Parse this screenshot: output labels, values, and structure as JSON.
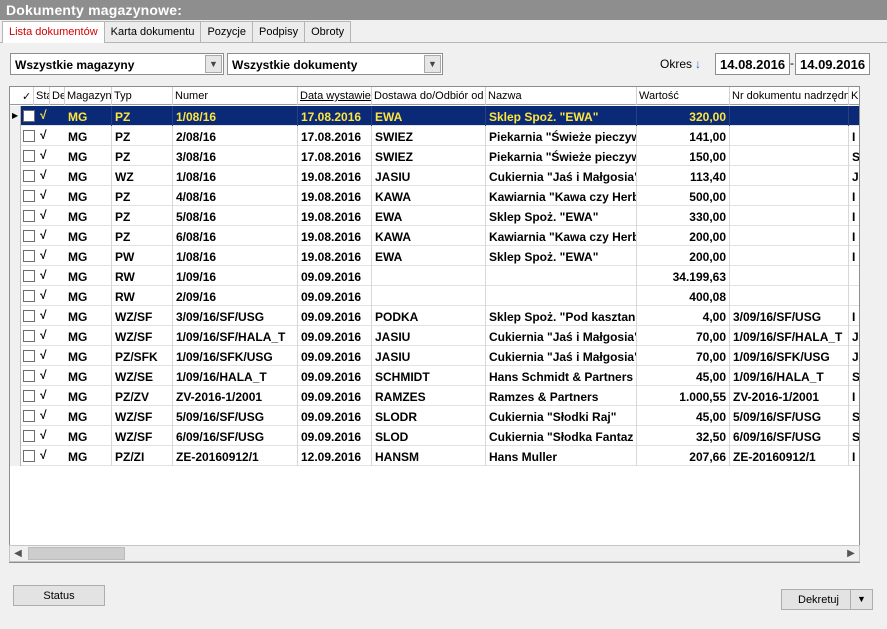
{
  "window": {
    "title": "Dokumenty magazynowe:"
  },
  "tabs": [
    {
      "label": "Lista dokumentów",
      "active": true
    },
    {
      "label": "Karta dokumentu",
      "active": false
    },
    {
      "label": "Pozycje",
      "active": false
    },
    {
      "label": "Podpisy",
      "active": false
    },
    {
      "label": "Obroty",
      "active": false
    }
  ],
  "filters": {
    "warehouse": "Wszystkie magazyny",
    "documents": "Wszystkie dokumenty",
    "period_label": "Okres",
    "date_from": "14.08.2016",
    "date_to": "14.09.2016",
    "date_separator": "-"
  },
  "table": {
    "headers": [
      "Sta",
      "De",
      "Magazyn",
      "Typ",
      "Numer",
      "Data wystawienia",
      "Dostawa do/Odbiór od",
      "Nazwa",
      "Wartość",
      "Nr dokumentu nadrzędnego",
      "K"
    ],
    "rows": [
      {
        "mag": "MG",
        "typ": "PZ",
        "numer": "1/08/16",
        "data": "17.08.2016",
        "dostawa": "EWA",
        "nazwa": "Sklep Spoż. \"EWA\"",
        "wartosc": "320,00",
        "nadrz": "",
        "k": "",
        "selected": true
      },
      {
        "mag": "MG",
        "typ": "PZ",
        "numer": "2/08/16",
        "data": "17.08.2016",
        "dostawa": "SWIEZ",
        "nazwa": "Piekarnia \"Świeże pieczyw",
        "wartosc": "141,00",
        "nadrz": "",
        "k": "I"
      },
      {
        "mag": "MG",
        "typ": "PZ",
        "numer": "3/08/16",
        "data": "17.08.2016",
        "dostawa": "SWIEZ",
        "nazwa": "Piekarnia \"Świeże pieczyw",
        "wartosc": "150,00",
        "nadrz": "",
        "k": "S"
      },
      {
        "mag": "MG",
        "typ": "WZ",
        "numer": "1/08/16",
        "data": "19.08.2016",
        "dostawa": "JASIU",
        "nazwa": "Cukiernia \"Jaś i Małgosia\"",
        "wartosc": "113,40",
        "nadrz": "",
        "k": "J"
      },
      {
        "mag": "MG",
        "typ": "PZ",
        "numer": "4/08/16",
        "data": "19.08.2016",
        "dostawa": "KAWA",
        "nazwa": "Kawiarnia \"Kawa czy Herb",
        "wartosc": "500,00",
        "nadrz": "",
        "k": "I"
      },
      {
        "mag": "MG",
        "typ": "PZ",
        "numer": "5/08/16",
        "data": "19.08.2016",
        "dostawa": "EWA",
        "nazwa": "Sklep Spoż. \"EWA\"",
        "wartosc": "330,00",
        "nadrz": "",
        "k": "I"
      },
      {
        "mag": "MG",
        "typ": "PZ",
        "numer": "6/08/16",
        "data": "19.08.2016",
        "dostawa": "KAWA",
        "nazwa": "Kawiarnia \"Kawa czy Herb",
        "wartosc": "200,00",
        "nadrz": "",
        "k": "I"
      },
      {
        "mag": "MG",
        "typ": "PW",
        "numer": "1/08/16",
        "data": "19.08.2016",
        "dostawa": "EWA",
        "nazwa": "Sklep Spoż. \"EWA\"",
        "wartosc": "200,00",
        "nadrz": "",
        "k": "I"
      },
      {
        "mag": "MG",
        "typ": "RW",
        "numer": "1/09/16",
        "data": "09.09.2016",
        "dostawa": "",
        "nazwa": "",
        "wartosc": "34.199,63",
        "nadrz": "",
        "k": ""
      },
      {
        "mag": "MG",
        "typ": "RW",
        "numer": "2/09/16",
        "data": "09.09.2016",
        "dostawa": "",
        "nazwa": "",
        "wartosc": "400,08",
        "nadrz": "",
        "k": ""
      },
      {
        "mag": "MG",
        "typ": "WZ/SF",
        "numer": "3/09/16/SF/USG",
        "data": "09.09.2016",
        "dostawa": "PODKA",
        "nazwa": "Sklep Spoż. \"Pod kasztan",
        "wartosc": "4,00",
        "nadrz": "3/09/16/SF/USG",
        "k": "I"
      },
      {
        "mag": "MG",
        "typ": "WZ/SF",
        "numer": "1/09/16/SF/HALA_T",
        "data": "09.09.2016",
        "dostawa": "JASIU",
        "nazwa": "Cukiernia \"Jaś i Małgosia\"",
        "wartosc": "70,00",
        "nadrz": "1/09/16/SF/HALA_T",
        "k": "J"
      },
      {
        "mag": "MG",
        "typ": "PZ/SFK",
        "numer": "1/09/16/SFK/USG",
        "data": "09.09.2016",
        "dostawa": "JASIU",
        "nazwa": "Cukiernia \"Jaś i Małgosia\"",
        "wartosc": "70,00",
        "nadrz": "1/09/16/SFK/USG",
        "k": "J"
      },
      {
        "mag": "MG",
        "typ": "WZ/SE",
        "numer": "1/09/16/HALA_T",
        "data": "09.09.2016",
        "dostawa": "SCHMIDT",
        "nazwa": "Hans Schmidt & Partners",
        "wartosc": "45,00",
        "nadrz": "1/09/16/HALA_T",
        "k": "S"
      },
      {
        "mag": "MG",
        "typ": "PZ/ZV",
        "numer": "ZV-2016-1/2001",
        "data": "09.09.2016",
        "dostawa": "RAMZES",
        "nazwa": "Ramzes & Partners",
        "wartosc": "1.000,55",
        "nadrz": "ZV-2016-1/2001",
        "k": "I"
      },
      {
        "mag": "MG",
        "typ": "WZ/SF",
        "numer": "5/09/16/SF/USG",
        "data": "09.09.2016",
        "dostawa": "SLODR",
        "nazwa": "Cukiernia \"Słodki Raj\"",
        "wartosc": "45,00",
        "nadrz": "5/09/16/SF/USG",
        "k": "S"
      },
      {
        "mag": "MG",
        "typ": "WZ/SF",
        "numer": "6/09/16/SF/USG",
        "data": "09.09.2016",
        "dostawa": "SLOD",
        "nazwa": "Cukiernia \"Słodka Fantaz",
        "wartosc": "32,50",
        "nadrz": "6/09/16/SF/USG",
        "k": "S"
      },
      {
        "mag": "MG",
        "typ": "PZ/ZI",
        "numer": "ZE-20160912/1",
        "data": "12.09.2016",
        "dostawa": "HANSM",
        "nazwa": "Hans Muller",
        "wartosc": "207,66",
        "nadrz": "ZE-20160912/1",
        "k": "I"
      }
    ]
  },
  "buttons": {
    "status": "Status",
    "dekretuj": "Dekretuj"
  },
  "icons": {
    "check": "✓",
    "tick": "√",
    "arrow_down": "▼",
    "sort_arrow": "🡇",
    "row_indicator": "▶",
    "scroll_left": "◀",
    "scroll_right": "▶"
  }
}
